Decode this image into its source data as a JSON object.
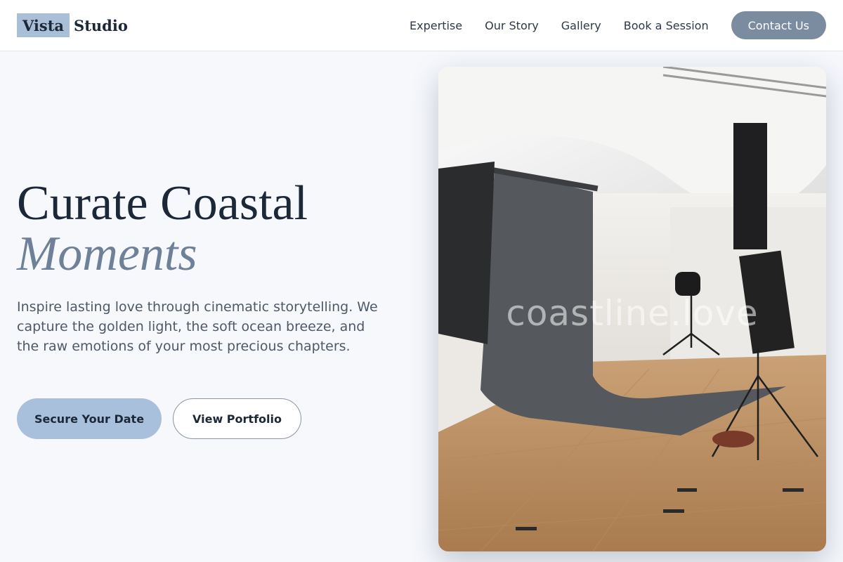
{
  "header": {
    "logo_part1": "Vista",
    "logo_part2": "Studio",
    "nav": [
      "Expertise",
      "Our Story",
      "Gallery",
      "Book a Session"
    ],
    "cta": "Contact Us"
  },
  "hero": {
    "title_line1": "Curate Coastal",
    "title_line2": "Moments",
    "description": "Inspire lasting love through cinematic storytelling. We capture the golden light, the soft ocean breeze, and the raw emotions of your most precious chapters.",
    "primary_button": "Secure Your Date",
    "secondary_button": "View Portfolio"
  },
  "photo": {
    "watermark": "coastline.love",
    "subject": "photo-studio-backdrop"
  },
  "colors": {
    "accent": "#a9c0dc",
    "nav_cta": "#7b8ca0",
    "title": "#1c2738",
    "title_accent": "#6e8198",
    "page_bg": "#f6f8fc"
  }
}
